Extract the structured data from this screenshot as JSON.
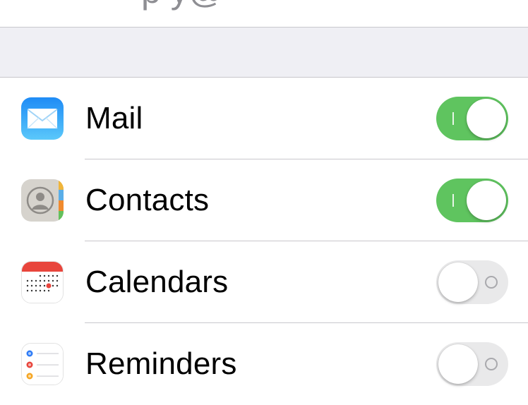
{
  "header": {
    "partial_title": "p     y@"
  },
  "rows": [
    {
      "label": "Mail",
      "icon": "mail-app-icon",
      "enabled": true
    },
    {
      "label": "Contacts",
      "icon": "contacts-app-icon",
      "enabled": true
    },
    {
      "label": "Calendars",
      "icon": "calendar-app-icon",
      "enabled": false
    },
    {
      "label": "Reminders",
      "icon": "reminders-app-icon",
      "enabled": false
    }
  ],
  "colors": {
    "toggle_on": "#5fc45f",
    "toggle_off": "#e9e9ea",
    "group_background": "#efeff4",
    "separator": "#c8c7cc"
  }
}
